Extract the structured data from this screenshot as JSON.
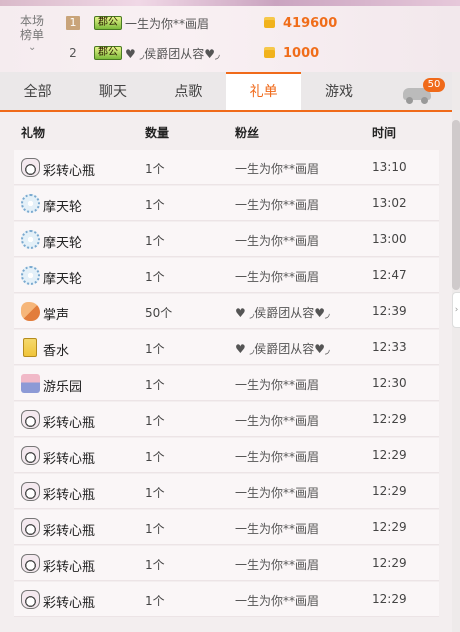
{
  "ranking": {
    "label_line1": "本场",
    "label_line2": "榜单",
    "rows": [
      {
        "rank": "1",
        "badge": "郡公",
        "name": "一生为你**画眉",
        "amount": "419600"
      },
      {
        "rank": "2",
        "badge": "郡公",
        "name": "♥ ◞侯爵团从容♥◞",
        "amount": "1000"
      }
    ]
  },
  "tabs": [
    "全部",
    "聊天",
    "点歌",
    "礼单",
    "游戏"
  ],
  "active_tab": "礼单",
  "car_badge": "50",
  "columns": {
    "gift": "礼物",
    "qty": "数量",
    "fan": "粉丝",
    "time": "时间"
  },
  "gifts": [
    {
      "icon": "bottle-icon",
      "name": "彩转心瓶",
      "qty": "1个",
      "fan": "一生为你**画眉",
      "time": "13:10"
    },
    {
      "icon": "ferris-wheel-icon",
      "name": "摩天轮",
      "qty": "1个",
      "fan": "一生为你**画眉",
      "time": "13:02"
    },
    {
      "icon": "ferris-wheel-icon",
      "name": "摩天轮",
      "qty": "1个",
      "fan": "一生为你**画眉",
      "time": "13:00"
    },
    {
      "icon": "ferris-wheel-icon",
      "name": "摩天轮",
      "qty": "1个",
      "fan": "一生为你**画眉",
      "time": "12:47"
    },
    {
      "icon": "clapping-hands-icon",
      "name": "掌声",
      "qty": "50个",
      "fan": "♥ ◞侯爵团从容♥◞",
      "time": "12:39"
    },
    {
      "icon": "perfume-icon",
      "name": "香水",
      "qty": "1个",
      "fan": "♥ ◞侯爵团从容♥◞",
      "time": "12:33"
    },
    {
      "icon": "amusement-park-icon",
      "name": "游乐园",
      "qty": "1个",
      "fan": "一生为你**画眉",
      "time": "12:30"
    },
    {
      "icon": "bottle-icon",
      "name": "彩转心瓶",
      "qty": "1个",
      "fan": "一生为你**画眉",
      "time": "12:29"
    },
    {
      "icon": "bottle-icon",
      "name": "彩转心瓶",
      "qty": "1个",
      "fan": "一生为你**画眉",
      "time": "12:29"
    },
    {
      "icon": "bottle-icon",
      "name": "彩转心瓶",
      "qty": "1个",
      "fan": "一生为你**画眉",
      "time": "12:29"
    },
    {
      "icon": "bottle-icon",
      "name": "彩转心瓶",
      "qty": "1个",
      "fan": "一生为你**画眉",
      "time": "12:29"
    },
    {
      "icon": "bottle-icon",
      "name": "彩转心瓶",
      "qty": "1个",
      "fan": "一生为你**画眉",
      "time": "12:29"
    },
    {
      "icon": "bottle-icon",
      "name": "彩转心瓶",
      "qty": "1个",
      "fan": "一生为你**画眉",
      "time": "12:29"
    }
  ]
}
